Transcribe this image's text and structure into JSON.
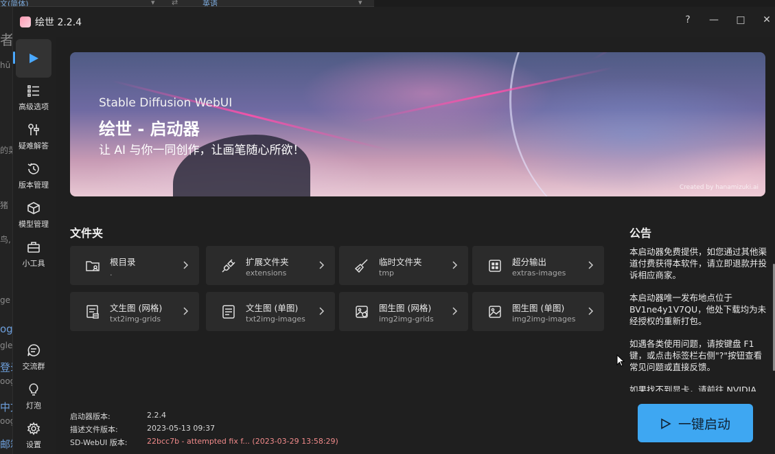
{
  "background_app": {
    "top_left_text": "文(简体)",
    "top_right_text": "英语",
    "left_fragments": [
      "者",
      "hū",
      "的菜",
      "猪",
      "鸟, 丰",
      "ge",
      "og",
      "gle",
      "登录",
      "oog",
      "中文",
      "oog",
      "邮箱"
    ]
  },
  "window": {
    "title": "绘世 2.2.4",
    "controls": {
      "help": "?",
      "minimize": "—",
      "maximize": "□",
      "close": "✕"
    }
  },
  "nav": {
    "items": [
      {
        "label": "",
        "icon": "play-icon",
        "active": true
      },
      {
        "label": "高级选项",
        "icon": "list-icon"
      },
      {
        "label": "疑难解答",
        "icon": "tools-icon"
      },
      {
        "label": "版本管理",
        "icon": "history-icon"
      },
      {
        "label": "模型管理",
        "icon": "cube-icon"
      },
      {
        "label": "小工具",
        "icon": "toolbox-icon"
      }
    ],
    "bottom_items": [
      {
        "label": "交流群",
        "icon": "chat-icon"
      },
      {
        "label": "灯泡",
        "icon": "bulb-icon"
      },
      {
        "label": "设置",
        "icon": "gear-icon"
      }
    ]
  },
  "banner": {
    "subtitle": "Stable Diffusion WebUI",
    "title": "绘世 - 启动器",
    "tagline": "让 AI 与你一同创作，让画笔随心所欲！",
    "credit": "Created by hanamizuki.ai"
  },
  "folders": {
    "title": "文件夹",
    "items": [
      {
        "name": "根目录",
        "path": ".",
        "icon": "folder-user-icon"
      },
      {
        "name": "扩展文件夹",
        "path": "extensions",
        "icon": "plug-icon"
      },
      {
        "name": "临时文件夹",
        "path": "tmp",
        "icon": "broom-icon"
      },
      {
        "name": "超分输出",
        "path": "extras-images",
        "icon": "grid-icon"
      },
      {
        "name": "文生图 (网格)",
        "path": "txt2img-grids",
        "icon": "text-grid-icon"
      },
      {
        "name": "文生图 (单图)",
        "path": "txt2img-images",
        "icon": "text-image-icon"
      },
      {
        "name": "图生图 (网格)",
        "path": "img2img-grids",
        "icon": "image-grid-icon"
      },
      {
        "name": "图生图 (单图)",
        "path": "img2img-images",
        "icon": "image-icon"
      }
    ]
  },
  "notice": {
    "title": "公告",
    "paragraphs": [
      "本启动器免费提供，如您通过其他渠道付费获得本软件，请立即退款并投诉相应商家。",
      "本启动器唯一发布地点位于BV1ne4y1V7QU，他处下载均为未经授权的重新打包。",
      "如遇各类使用问题，请按键盘 F1 键，或点击标签栏右侧\"?\"按钮查看常见问题或直接反馈。",
      "如果找不到显卡，请前往 NVIDIA"
    ]
  },
  "versions": {
    "launcher_label": "启动器版本:",
    "launcher_value": "2.2.4",
    "desc_label": "描述文件版本:",
    "desc_value": "2023-05-13 09:37",
    "webui_label": "SD-WebUI 版本:",
    "webui_value": "22bcc7b - attempted fix f... (2023-03-29 13:58:29)"
  },
  "launch": {
    "label": "一键启动"
  },
  "colors": {
    "accent": "#3ea7f2",
    "nav_indicator": "#4aa8ff",
    "warn": "#f28b8b"
  }
}
